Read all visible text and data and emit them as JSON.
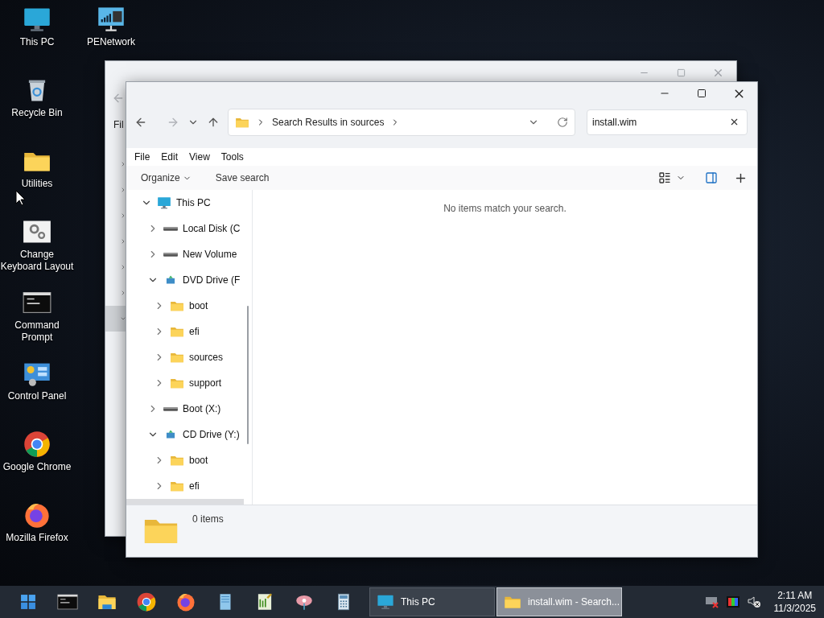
{
  "desktop_icons": [
    {
      "kind": "pc",
      "label": "This PC"
    },
    {
      "kind": "recycle",
      "label": "Recycle Bin"
    },
    {
      "kind": "folder",
      "label": "Utilities"
    },
    {
      "kind": "gears",
      "label": "Change Keyboard Layout"
    },
    {
      "kind": "console",
      "label": "Command Prompt"
    },
    {
      "kind": "panel",
      "label": "Control Panel"
    },
    {
      "kind": "chrome",
      "label": "Google Chrome"
    },
    {
      "kind": "firefox",
      "label": "Mozilla Firefox"
    },
    {
      "kind": "network",
      "label": "PENetwork"
    }
  ],
  "back_window": {
    "menu_stub": "Fil"
  },
  "window": {
    "address": "Search Results in sources",
    "search": {
      "value": "install.wim"
    },
    "menu": [
      "File",
      "Edit",
      "View",
      "Tools"
    ],
    "commands": [
      {
        "label": "Organize",
        "dropdown": true
      },
      {
        "label": "Save search",
        "dropdown": false
      }
    ],
    "tree": [
      {
        "kind": "pc",
        "label": "This PC",
        "expanded": true,
        "selected": false,
        "children": [
          {
            "kind": "drive",
            "label": "Local Disk (C",
            "expanded": false,
            "selected": false
          },
          {
            "kind": "drive",
            "label": "New Volume",
            "expanded": false,
            "selected": false
          },
          {
            "kind": "dvd",
            "label": "DVD Drive (F",
            "expanded": true,
            "selected": false,
            "children": [
              {
                "kind": "folder",
                "label": "boot",
                "expanded": false,
                "selected": false
              },
              {
                "kind": "folder",
                "label": "efi",
                "expanded": false,
                "selected": false
              },
              {
                "kind": "folder",
                "label": "sources",
                "expanded": false,
                "selected": false
              },
              {
                "kind": "folder",
                "label": "support",
                "expanded": false,
                "selected": false
              }
            ]
          },
          {
            "kind": "drive",
            "label": "Boot (X:)",
            "expanded": false,
            "selected": false
          },
          {
            "kind": "dvd",
            "label": "CD Drive (Y:)",
            "expanded": true,
            "selected": false,
            "children": [
              {
                "kind": "folder",
                "label": "boot",
                "expanded": false,
                "selected": false
              },
              {
                "kind": "folder",
                "label": "efi",
                "expanded": false,
                "selected": false
              }
            ]
          }
        ]
      }
    ],
    "empty_message": "No items match your search.",
    "status": "0 items"
  },
  "taskbar": {
    "pinned": [
      {
        "kind": "start"
      },
      {
        "kind": "console"
      },
      {
        "kind": "explorer"
      },
      {
        "kind": "chrome"
      },
      {
        "kind": "firefox"
      },
      {
        "kind": "notepad"
      },
      {
        "kind": "editor"
      },
      {
        "kind": "paint"
      },
      {
        "kind": "calculator"
      }
    ],
    "tasks": [
      {
        "kind": "pc",
        "label": "This PC",
        "selected": false
      },
      {
        "kind": "folder",
        "label": "install.wim - Search...",
        "selected": true
      }
    ],
    "time": "2:11 AM",
    "date": "11/3/2025"
  }
}
